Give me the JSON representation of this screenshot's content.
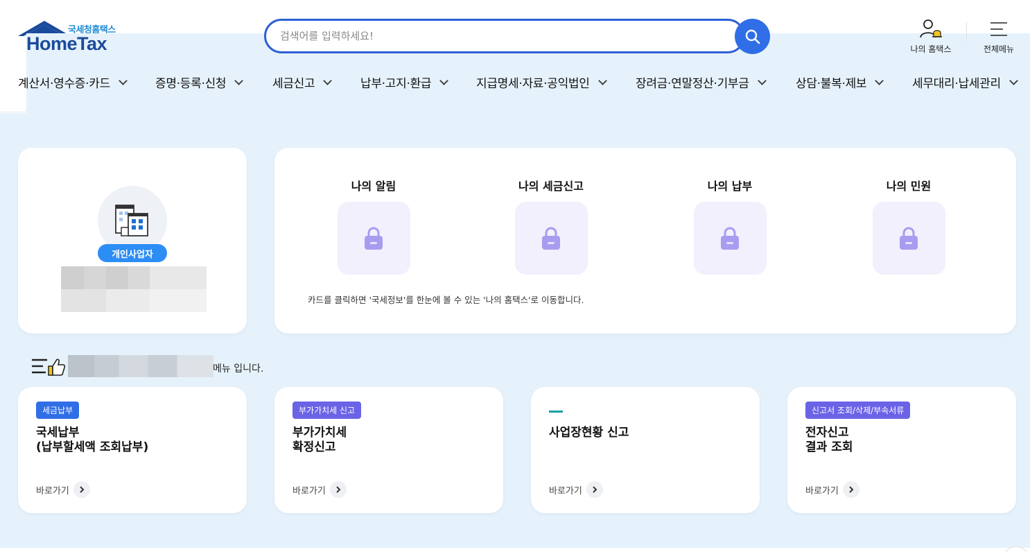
{
  "header": {
    "logo_sub": "국세청홈택스",
    "logo_main": "HomeTax",
    "search_placeholder": "검색어를 입력하세요!",
    "my_hometax": "나의 홈택스",
    "all_menu": "전체메뉴"
  },
  "gnb": [
    {
      "label": "계산서·영수증·카드"
    },
    {
      "label": "증명·등록·신청"
    },
    {
      "label": "세금신고"
    },
    {
      "label": "납부·고지·환급"
    },
    {
      "label": "지급명세·자료·공익법인"
    },
    {
      "label": "장려금·연말정산·기부금"
    },
    {
      "label": "상담·불복·제보"
    },
    {
      "label": "세무대리·납세관리"
    }
  ],
  "profile": {
    "type_badge": "개인사업자"
  },
  "my": {
    "items": [
      {
        "title": "나의 알림",
        "icon": "lock-icon"
      },
      {
        "title": "나의 세금신고",
        "icon": "lock-icon"
      },
      {
        "title": "나의 납부",
        "icon": "lock-icon"
      },
      {
        "title": "나의 민원",
        "icon": "lock-icon"
      }
    ],
    "note": "카드를 클릭하면 '국세정보'를 한눈에 볼 수 있는 '나의 홈택스'로 이동합니다."
  },
  "recommend": {
    "suffix": "메뉴 입니다."
  },
  "quick_cards": [
    {
      "tag": "세금납부",
      "tag_color": "#2f6ee6",
      "title": "국세납부\n(납부할세액 조회납부)",
      "link": "바로가기"
    },
    {
      "tag": "부가가치세 신고",
      "tag_color": "#6b63e6",
      "title": "부가가치세\n확정신고",
      "link": "바로가기"
    },
    {
      "tag": "",
      "tag_color": "#17a1a6",
      "title": "사업장현황 신고",
      "link": "바로가기"
    },
    {
      "tag": "신고서 조회/삭제/부속서류",
      "tag_color": "#6b63e6",
      "title": "전자신고\n결과 조회",
      "link": "바로가기"
    }
  ],
  "colors": {
    "brand_blue": "#2f6ee6",
    "bg_light_blue": "#e6f2fb",
    "lock_purple": "#a89cf0"
  }
}
